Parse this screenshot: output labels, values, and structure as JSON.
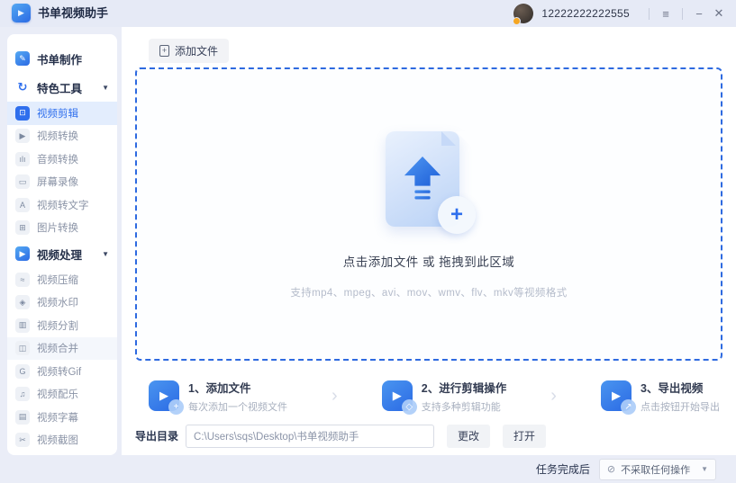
{
  "titlebar": {
    "title": "书单视频助手",
    "account": "12222222222555"
  },
  "icons": {
    "app": "▶",
    "menu": "≡",
    "minimize": "−",
    "close": "✕",
    "file_plus": "+",
    "plus": "+",
    "play": "▶",
    "step_chevron": "›",
    "no_action": "⊘",
    "dropdown_chevron": "▼",
    "section_caret": "▼"
  },
  "sidebar": {
    "items": [
      {
        "label": "书单制作",
        "glyph": "✎"
      },
      {
        "label": "特色工具",
        "glyph": "↻"
      },
      {
        "label": "视频剪辑",
        "glyph": "⊡"
      },
      {
        "label": "视频转换",
        "glyph": "▶"
      },
      {
        "label": "音频转换",
        "glyph": "ılı"
      },
      {
        "label": "屏幕录像",
        "glyph": "▭"
      },
      {
        "label": "视频转文字",
        "glyph": "A"
      },
      {
        "label": "图片转换",
        "glyph": "⊞"
      },
      {
        "label": "视频处理",
        "glyph": "▶"
      },
      {
        "label": "视频压缩",
        "glyph": "≈"
      },
      {
        "label": "视频水印",
        "glyph": "◈"
      },
      {
        "label": "视频分割",
        "glyph": "▥"
      },
      {
        "label": "视频合并",
        "glyph": "◫"
      },
      {
        "label": "视频转Gif",
        "glyph": "G"
      },
      {
        "label": "视频配乐",
        "glyph": "♫"
      },
      {
        "label": "视频字幕",
        "glyph": "▤"
      },
      {
        "label": "视频截图",
        "glyph": "✂"
      }
    ]
  },
  "toolbar": {
    "add_file_label": "添加文件"
  },
  "dropzone": {
    "main_text": "点击添加文件 或 拖拽到此区域",
    "sub_text": "支持mp4、mpeg、avi、mov、wmv、flv、mkv等视频格式"
  },
  "steps": [
    {
      "title": "1、添加文件",
      "desc": "每次添加一个视频文件",
      "badge": "+"
    },
    {
      "title": "2、进行剪辑操作",
      "desc": "支持多种剪辑功能",
      "badge": "◇"
    },
    {
      "title": "3、导出视频",
      "desc": "点击按钮开始导出",
      "badge": "↗"
    }
  ],
  "export": {
    "label": "导出目录",
    "path": "C:\\Users\\sqs\\Desktop\\书单视频助手",
    "change_btn": "更改",
    "open_btn": "打开"
  },
  "statusbar": {
    "label": "任务完成后",
    "dropdown_value": "不采取任何操作"
  },
  "colors": {
    "accent": "#2f6fed",
    "dashed_border": "#2e6ae0",
    "sidebar_selected_bg": "#e3edfd"
  }
}
